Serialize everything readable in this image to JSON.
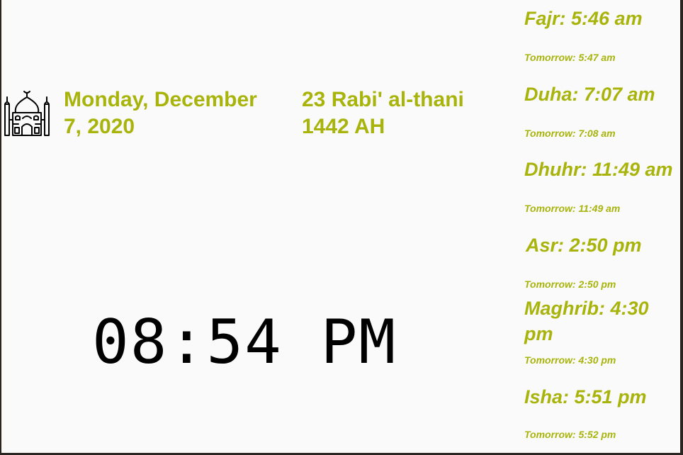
{
  "header": {
    "gregorian_date": "Monday, December 7, 2020",
    "hijri_date": "23 Rabi' al-thani 1442 AH"
  },
  "clock": {
    "time": "08:54 PM"
  },
  "prayers": [
    {
      "name": "Fajr: 5:46 am",
      "tomorrow": "Tomorrow: 5:47 am"
    },
    {
      "name": "Duha: 7:07 am",
      "tomorrow": "Tomorrow: 7:08 am"
    },
    {
      "name": "Dhuhr: 11:49 am",
      "tomorrow": "Tomorrow: 11:49 am"
    },
    {
      "name": "Asr: 2:50 pm",
      "tomorrow": "Tomorrow: 2:50 pm"
    },
    {
      "name": "Maghrib: 4:30 pm",
      "tomorrow": "Tomorrow: 4:30 pm"
    },
    {
      "name": "Isha: 5:51 pm",
      "tomorrow": "Tomorrow: 5:52 pm"
    }
  ],
  "colors": {
    "accent": "#a8b40c",
    "background": "#fafafa",
    "clock_text": "#000000"
  },
  "icons": {
    "logo": "mosque-icon"
  }
}
